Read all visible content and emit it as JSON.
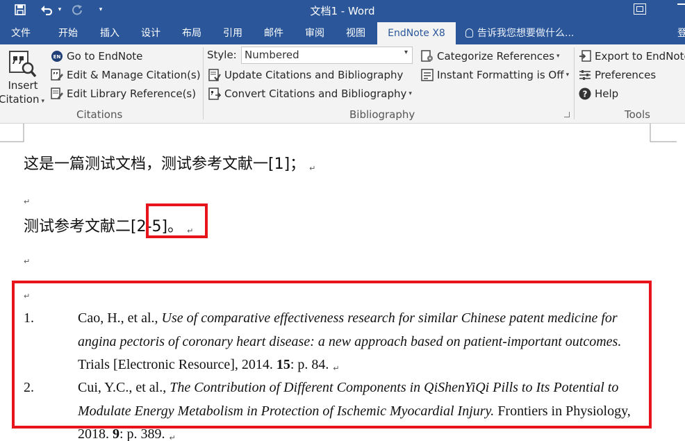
{
  "titlebar": {
    "doc_title": "文档1 - Word",
    "save_icon": "save-icon",
    "undo_icon": "undo-icon",
    "redo_icon": "redo-icon",
    "customize_icon": "customize-qat-icon"
  },
  "tabs": [
    {
      "label": "文件"
    },
    {
      "label": "开始"
    },
    {
      "label": "插入"
    },
    {
      "label": "设计"
    },
    {
      "label": "布局"
    },
    {
      "label": "引用"
    },
    {
      "label": "邮件"
    },
    {
      "label": "审阅"
    },
    {
      "label": "视图"
    },
    {
      "label": "EndNote X8",
      "active": true
    }
  ],
  "tell_me": "告诉我您想要做什么...",
  "tab_overflow": "登",
  "ribbon": {
    "citations": {
      "insert_citation_line1": "Insert",
      "insert_citation_line2": "Citation",
      "go_to_endnote": "Go to EndNote",
      "edit_manage": "Edit & Manage Citation(s)",
      "edit_library": "Edit Library Reference(s)",
      "group_label": "Citations"
    },
    "bibliography": {
      "style_label": "Style:",
      "style_value": "Numbered",
      "update": "Update Citations and Bibliography",
      "convert": "Convert Citations and Bibliography",
      "categorize": "Categorize References",
      "instant_formatting": "Instant Formatting is Off",
      "group_label": "Bibliography"
    },
    "tools": {
      "export": "Export to EndNote",
      "preferences": "Preferences",
      "help": "Help",
      "group_label": "Tools"
    }
  },
  "document": {
    "line1": "这是一篇测试文档，测试参考文献一[1]；",
    "line2_text": "测试参考文献二",
    "line2_citation": "[2-5]",
    "line2_end": "。",
    "paragraph_mark": "↵",
    "references": [
      {
        "num": "1.",
        "authors": "Cao, H., et al., ",
        "title": "Use of comparative effectiveness research for similar Chinese patent medicine for angina pectoris of coronary heart disease: a new approach based on patient-important outcomes.",
        "source": " Trials [Electronic Resource], 2014. ",
        "volume": "15",
        "pages": ": p. 84."
      },
      {
        "num": "2.",
        "authors": "Cui, Y.C., et al., ",
        "title": "The Contribution of Different Components in QiShenYiQi Pills to Its Potential to Modulate Energy Metabolism in Protection of Ischemic Myocardial Injury.",
        "source": " Frontiers in Physiology, 2018. ",
        "volume": "9",
        "pages": ": p. 389."
      }
    ]
  },
  "colors": {
    "word_blue": "#2b579a",
    "ribbon_bg": "#f3f3f3",
    "highlight_red": "#e8141c"
  }
}
